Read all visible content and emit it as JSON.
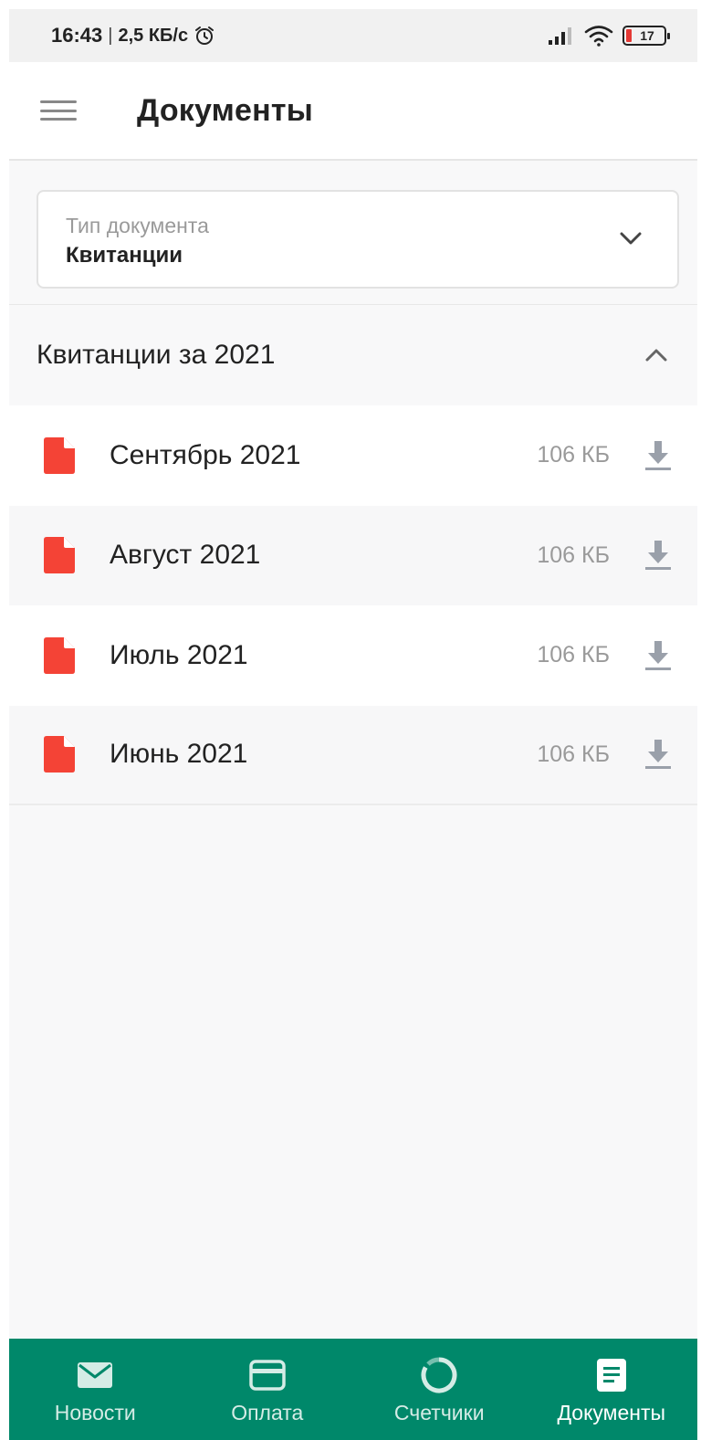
{
  "status_bar": {
    "time": "16:43",
    "separator": "|",
    "speed": "2,5 КБ/с",
    "battery_level": "17"
  },
  "app_bar": {
    "title": "Документы"
  },
  "document_type": {
    "label": "Тип документа",
    "value": "Квитанции"
  },
  "section": {
    "title": "Квитанции за 2021"
  },
  "documents": [
    {
      "name": "Сентябрь 2021",
      "size": "106 КБ"
    },
    {
      "name": "Август 2021",
      "size": "106 КБ"
    },
    {
      "name": "Июль 2021",
      "size": "106 КБ"
    },
    {
      "name": "Июнь 2021",
      "size": "106 КБ"
    }
  ],
  "bottom_nav": {
    "items": [
      {
        "label": "Новости",
        "icon": "mail-icon"
      },
      {
        "label": "Оплата",
        "icon": "card-icon"
      },
      {
        "label": "Счетчики",
        "icon": "meter-icon"
      },
      {
        "label": "Документы",
        "icon": "document-icon"
      }
    ],
    "active": "Документы"
  },
  "colors": {
    "accent": "#00886a",
    "pdf_red": "#f44336",
    "battery_low": "#e53935"
  }
}
